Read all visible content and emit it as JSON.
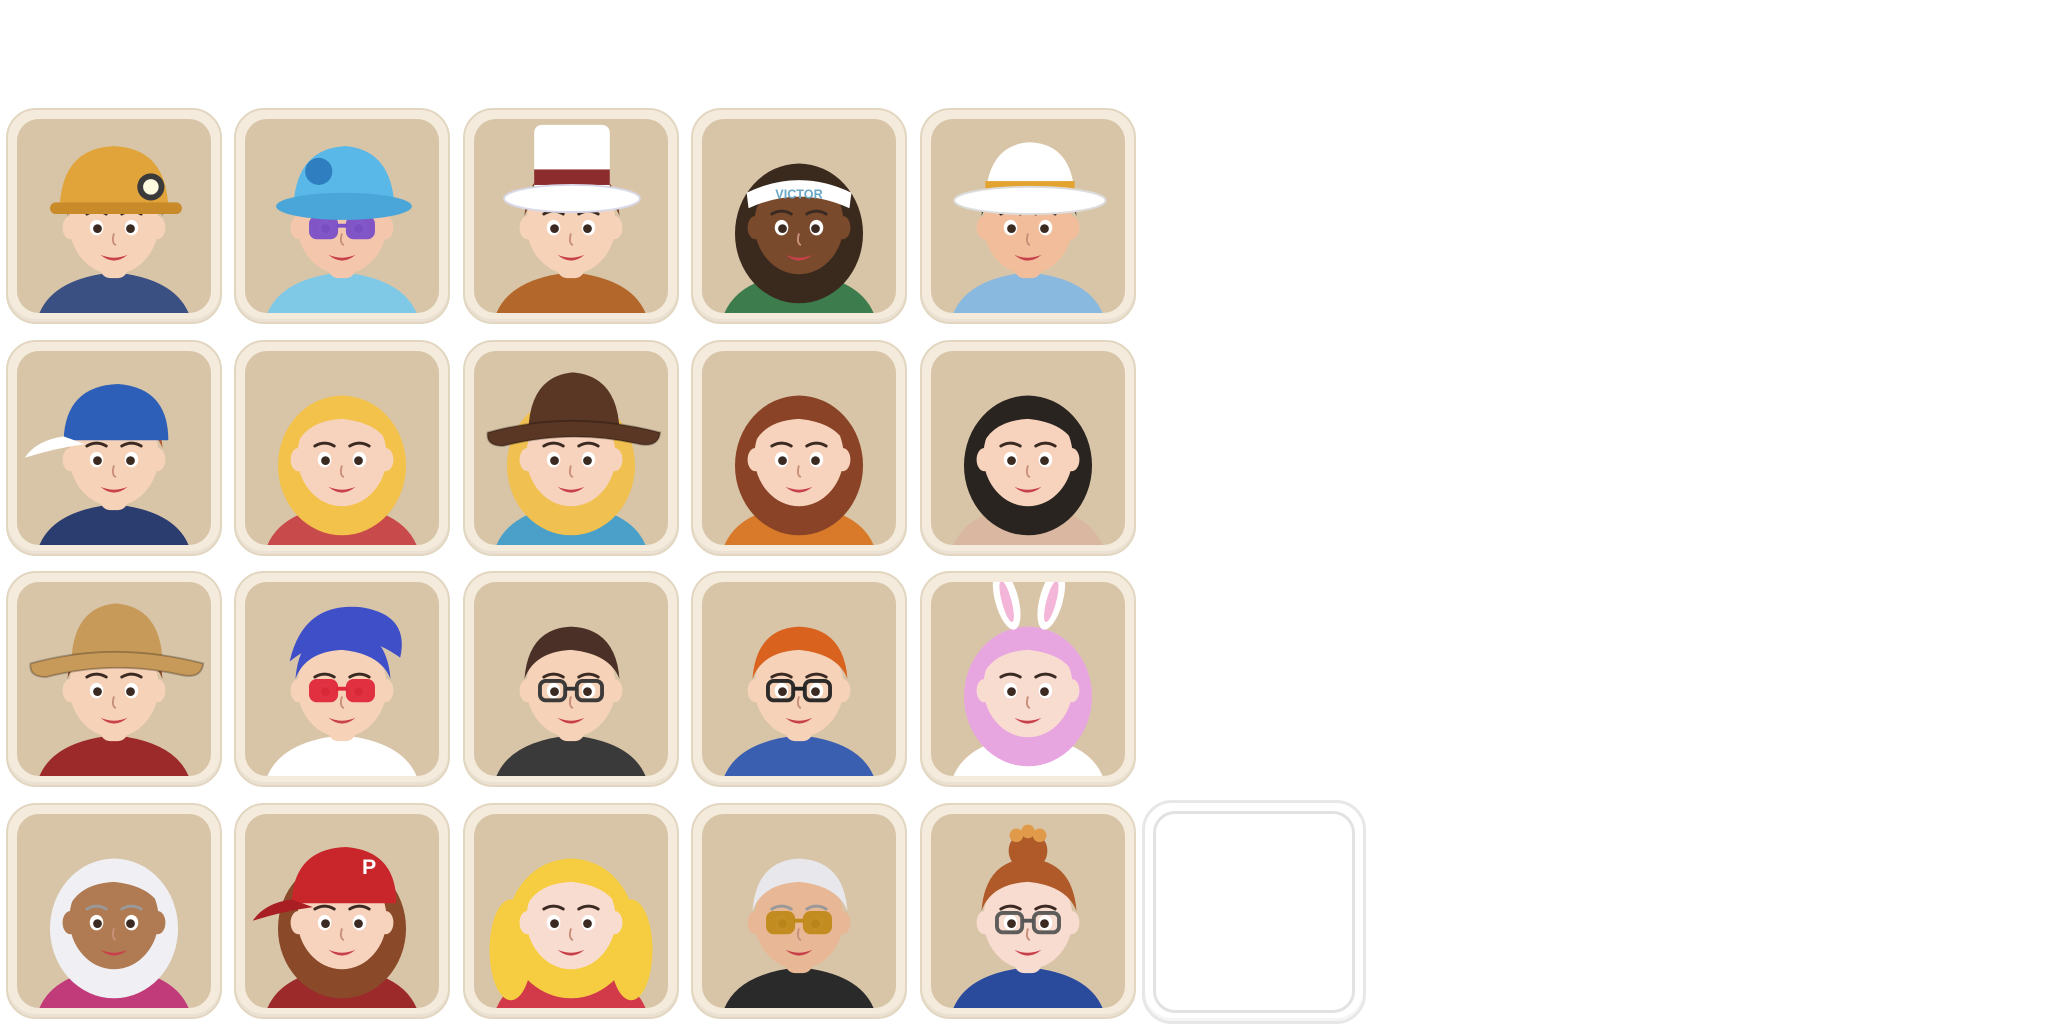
{
  "sheet": {
    "name": "avatar-frames",
    "background": "#ffffff",
    "frame_fill": "#f4ebdc",
    "panel_fill": "#d8c5a8",
    "slot_border": "#e2e2e2"
  },
  "avatars": [
    {
      "name": "miner-boy",
      "hat": "hardhat",
      "hat_color": "#e0a43a",
      "hair": "#3a2a22",
      "skin": "#f6d2b8",
      "outfit": "#3a4f82",
      "text": ""
    },
    {
      "name": "granny-sunglasses",
      "hat": "bucket",
      "hat_color": "#59b8e8",
      "hair": "#eeeeee",
      "skin": "#f4c7ad",
      "outfit": "#7fc9e6",
      "glasses": "#7b4fc8",
      "text": ""
    },
    {
      "name": "top-hat-boy",
      "hat": "tophat",
      "hat_color": "#ffffff",
      "band": "#8c2c2c",
      "hair": "#7a3f22",
      "skin": "#f6d2b8",
      "outfit": "#b3672a",
      "text": ""
    },
    {
      "name": "dreadlock-man",
      "hat": "headband",
      "hat_color": "#ffffff",
      "hair": "#3a2a1e",
      "skin": "#7a4a2c",
      "outfit": "#3d7c4c",
      "text": "VICTOR"
    },
    {
      "name": "mobster-boss",
      "hat": "fedora",
      "hat_color": "#ffffff",
      "band": "#e3a331",
      "hair": "#2b2b2b",
      "skin": "#f2bd9a",
      "outfit": "#8ab9e0",
      "text": ""
    },
    {
      "name": "cap-boy",
      "hat": "cap",
      "hat_color": "#2e5fb8",
      "hair": "#b3582c",
      "skin": "#f6d2b8",
      "outfit": "#2b3c6e",
      "text": ""
    },
    {
      "name": "blonde-diva",
      "hat": "none",
      "hair": "#f2c24a",
      "skin": "#f7d3bd",
      "outfit": "#c94a4a",
      "text": ""
    },
    {
      "name": "cowgirl",
      "hat": "cowboy",
      "hat_color": "#5a3624",
      "hair": "#f0c050",
      "skin": "#f7d3bd",
      "outfit": "#4aa0c8",
      "text": ""
    },
    {
      "name": "curly-brunette",
      "hat": "none",
      "hair": "#8a4326",
      "skin": "#f7d3bd",
      "outfit": "#d87a2a",
      "text": ""
    },
    {
      "name": "dark-hair-lady",
      "hat": "none",
      "hair": "#2a2420",
      "skin": "#f7d3bd",
      "outfit": "#d9b7a0",
      "text": ""
    },
    {
      "name": "cowboy-gunslinger",
      "hat": "cowboy",
      "hat_color": "#c89a5a",
      "hair": "#8a4a2a",
      "skin": "#f6d2b8",
      "outfit": "#9c2a2a",
      "text": ""
    },
    {
      "name": "rockabilly-singer",
      "hat": "none",
      "hair": "#3f4fc8",
      "skin": "#f6d2b8",
      "outfit": "#ffffff",
      "glasses": "#e0283a",
      "text": ""
    },
    {
      "name": "glasses-gentleman",
      "hat": "none",
      "hair": "#4a3026",
      "skin": "#f6d2b8",
      "outfit": "#3a3a3a",
      "glasses": "#333333",
      "text": ""
    },
    {
      "name": "ginger-nerd",
      "hat": "none",
      "hair": "#d9621e",
      "skin": "#f6d2b8",
      "outfit": "#3a5fb0",
      "glasses": "#222222",
      "text": ""
    },
    {
      "name": "bunny-girl",
      "hat": "bunny",
      "hat_color": "#ffffff",
      "hair": "#e8a6e0",
      "skin": "#f9dcd0",
      "outfit": "#ffffff",
      "text": ""
    },
    {
      "name": "silver-hair-lady",
      "hat": "none",
      "hair": "#f0f0f4",
      "skin": "#b07a52",
      "outfit": "#c13a7a",
      "text": ""
    },
    {
      "name": "red-cap-girl",
      "hat": "cap",
      "hat_color": "#c8262a",
      "hair": "#8a4a2a",
      "skin": "#f7d3bd",
      "outfit": "#9c2a2a",
      "text": "P"
    },
    {
      "name": "pigtail-blonde",
      "hat": "none",
      "hair": "#f6cd40",
      "skin": "#f9dcd0",
      "outfit": "#d23a4a",
      "text": ""
    },
    {
      "name": "old-man-pipe",
      "hat": "none",
      "hair": "#e8e8ec",
      "skin": "#e8b896",
      "outfit": "#2a2a2a",
      "glasses": "#c08a1a",
      "text": ""
    },
    {
      "name": "bun-glasses-girl",
      "hat": "none",
      "hair": "#b05a2a",
      "skin": "#f9dcd0",
      "outfit": "#2a4a9c",
      "glasses": "#555555",
      "text": ""
    }
  ]
}
